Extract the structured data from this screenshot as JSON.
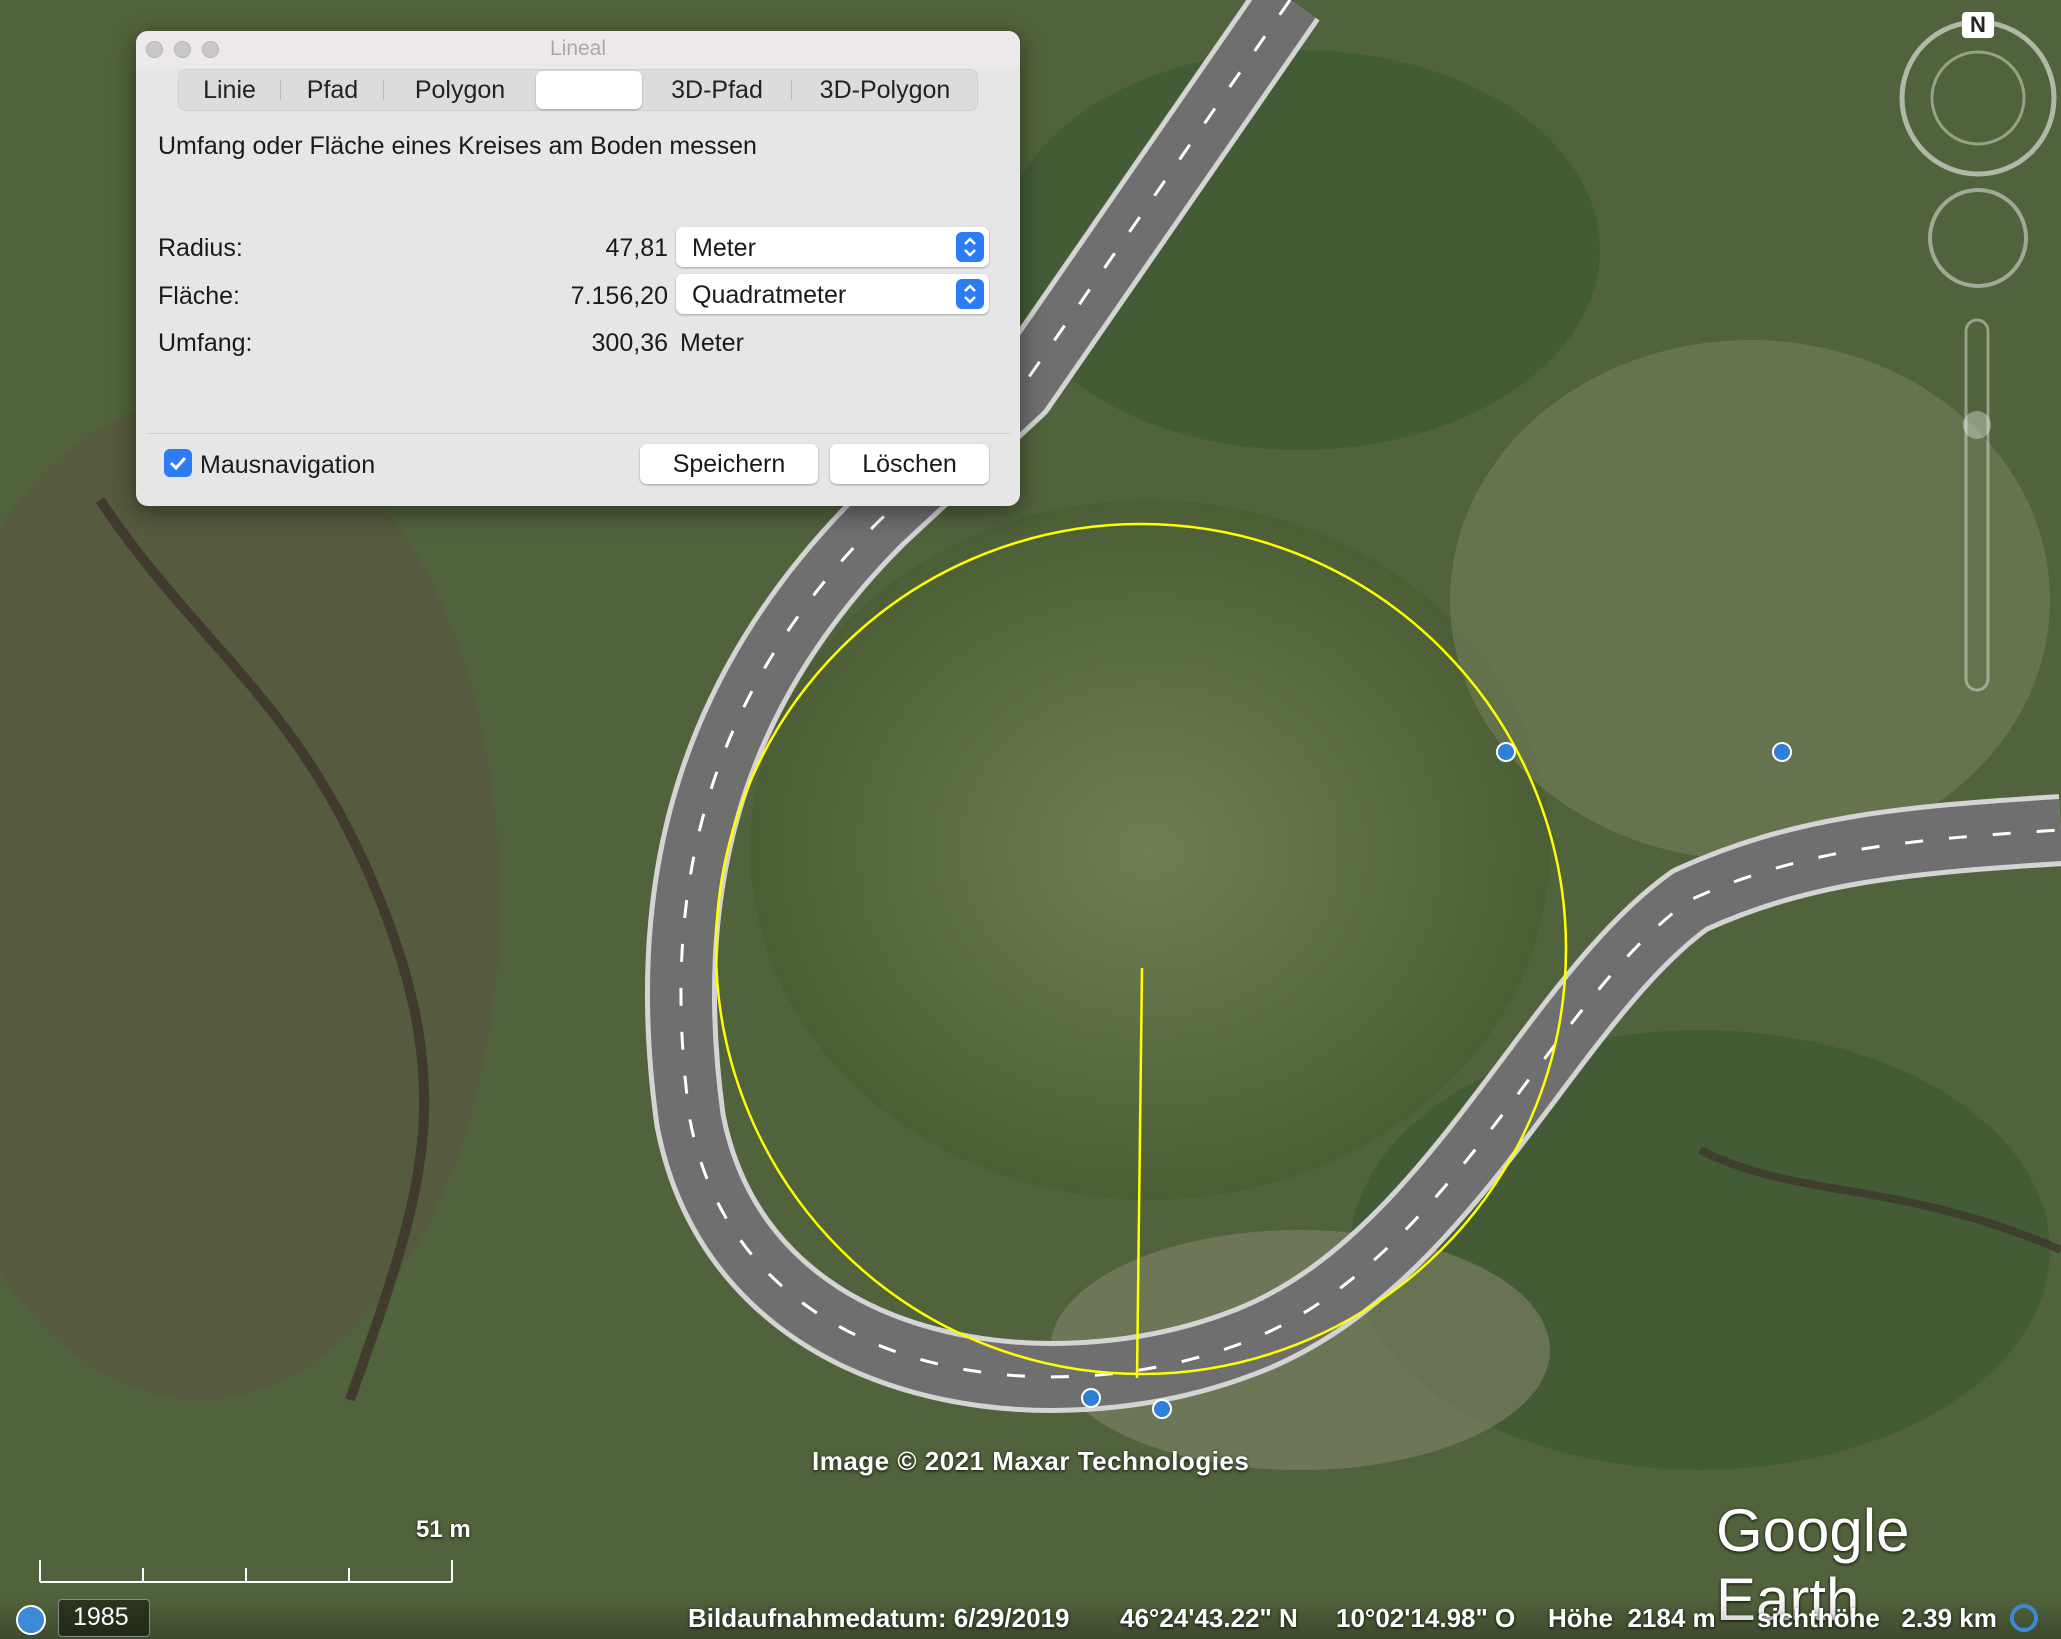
{
  "dialog": {
    "title": "Lineal",
    "tabs": [
      {
        "label": "Linie"
      },
      {
        "label": "Pfad"
      },
      {
        "label": "Polygon"
      },
      {
        "label": ""
      },
      {
        "label": "3D-Pfad"
      },
      {
        "label": "3D-Polygon"
      }
    ],
    "active_tab_index": 3,
    "description": "Umfang oder Fläche eines Kreises am Boden messen",
    "radius": {
      "label": "Radius:",
      "value": "47,81",
      "unit": "Meter"
    },
    "area": {
      "label": "Fläche:",
      "value": "7.156,20",
      "unit": "Quadratmeter"
    },
    "perimeter": {
      "label": "Umfang:",
      "value": "300,36",
      "unit": "Meter"
    },
    "mouse_nav": {
      "label": "Mausnavigation",
      "checked": true
    },
    "save_label": "Speichern",
    "delete_label": "Löschen"
  },
  "map": {
    "copyright": "Image © 2021 Maxar Technologies",
    "logo": "Google Earth",
    "compass_north": "N",
    "scale_label": "51 m",
    "measure_color": "#ffff00"
  },
  "status_bar": {
    "history_year": "1985",
    "imagery_date": "Bildaufnahmedatum: 6/29/2019",
    "latitude": "46°24'43.22\" N",
    "longitude": "10°02'14.98\" O",
    "elevation": "Höhe  2184 m",
    "eye_altitude": "sichthöhe   2.39 km"
  }
}
